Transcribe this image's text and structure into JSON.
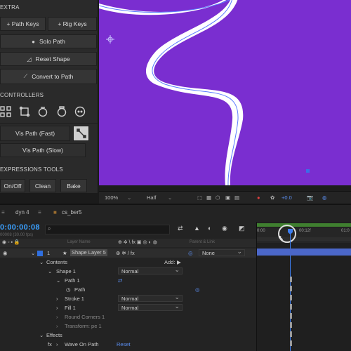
{
  "left_panel": {
    "extra_label": "EXTRA",
    "path_keys": "+ Path Keys",
    "rig_keys": "+ Rig Keys",
    "solo_path": "Solo Path",
    "reset_shape": "Reset Shape",
    "convert_to_path": "Convert to Path",
    "controllers_label": "CONTROLLERS",
    "vis_path_fast": "Vis Path (Fast)",
    "vis_path_slow": "Vis Path (Slow)",
    "expressions_label": "EXPRESSIONS TOOLS",
    "on_off": "On/Off",
    "clean": "Clean",
    "bake": "Bake"
  },
  "viewer": {
    "zoom": "100%",
    "resolution": "Half",
    "exposure": "+0.0",
    "colors": {
      "comp_bg": "#7a2ed0",
      "stroke": "#ffffff",
      "path": "#5a7cff"
    }
  },
  "timeline": {
    "tab_1": "dyn 4",
    "tab_2": "cs_ber5",
    "timecode": "0:00:00:08",
    "timecode_sub": "00008 (30.00 fps)",
    "col_layer_name": "Layer Name",
    "col_parent": "Parent & Link",
    "time_label_0": "0:00",
    "time_label_1": "00:12f",
    "time_label_2": "01:0",
    "layer_num": "1",
    "layer_name": "Shape Layer 5",
    "parent_value": "None",
    "contents": "Contents",
    "add": "Add:",
    "shape_1": "Shape 1",
    "shape_1_mode": "Normal",
    "path_1": "Path 1",
    "path": "Path",
    "stroke_1": "Stroke 1",
    "stroke_mode": "Normal",
    "fill_1": "Fill 1",
    "fill_mode": "Normal",
    "round_corners": "Round Corners 1",
    "transform": "Transform: pe 1",
    "effects": "Effects",
    "wave_on_path": "Wave On Path",
    "reset": "Reset"
  }
}
